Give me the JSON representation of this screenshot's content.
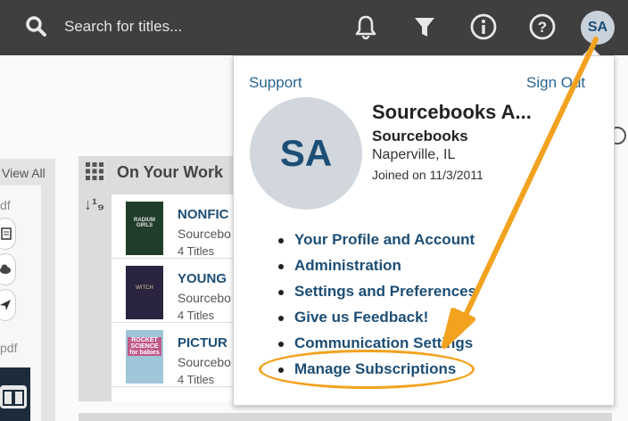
{
  "topbar": {
    "search_placeholder": "Search for titles...",
    "avatar_initials": "SA",
    "icons": [
      "search-icon",
      "bell-icon",
      "filter-icon",
      "info-icon",
      "help-icon"
    ]
  },
  "left_card": {
    "view_all": "View All",
    "pdf_label_1": "df",
    "pdf_label_2": "pdf"
  },
  "mid_card": {
    "title": "On Your Work",
    "sort_label": "↓¹₉",
    "rows": [
      {
        "title": "NONFIC",
        "publisher": "Sourcebo",
        "count": "4 Titles",
        "cover_text": "RADIUM GIRLS"
      },
      {
        "title": "YOUNG",
        "publisher": "Sourcebo",
        "count": "4 Titles",
        "cover_text": "WITCH"
      },
      {
        "title": "PICTUR",
        "publisher": "Sourcebo",
        "count": "4 Titles",
        "cover_text": "ROCKET SCIENCE for babies"
      }
    ]
  },
  "dropdown": {
    "support": "Support",
    "sign_out": "Sign Out",
    "avatar_initials": "SA",
    "user_name": "Sourcebooks A...",
    "org": "Sourcebooks",
    "location": "Naperville, IL",
    "joined": "Joined on 11/3/2011",
    "menu": [
      "Your Profile and Account",
      "Administration",
      "Settings and Preferences",
      "Give us Feedback!",
      "Communication Settings",
      "Manage Subscriptions"
    ]
  },
  "colors": {
    "topbar": "#3f3f3f",
    "link": "#2a6592",
    "menu": "#1d4e75",
    "annotation": "#f3a21f"
  }
}
